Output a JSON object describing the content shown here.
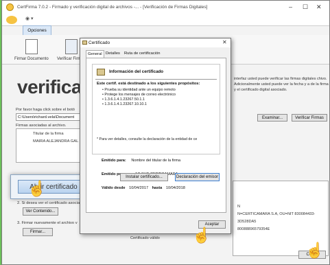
{
  "app": {
    "title": "CertFirma 7.0.2 - Firmado y verificación digital de archivos -... - [Verificación de Firmas Digitales]",
    "tab": "Opciones",
    "toolbar": [
      "Firmar Documento",
      "Verificar Firm"
    ],
    "big_title": "verifica",
    "instruction": "Por favor haga click sobre el botó",
    "path_value": "C:\\Users\\richard.vela\\Document",
    "firmas_label": "Firmas asociadas al archivo.",
    "grid_header": "Titular de la firma",
    "grid_row": "MAIRA ALEJANDRA GAL",
    "examinar_label": "Examinar...",
    "verificar_label": "Verificar Firmas",
    "right_text": "interfaz usted puede verificar las firmas digitales chivo.  Adicionalmente usted puede ver la fecha y a de la firma y el certificado digital asociado.",
    "right_panel_lines": [
      "N",
      "N=CERTICAMARA S.A, OU=NIT 830084433-",
      "3D528DA5",
      "80088896579354E"
    ],
    "step2_partial": "2. Si desea ver el certificado asociado a la firma",
    "ver_contenido_label": "Ver Contenido...",
    "step3": "3. Firmar nuevamente el archivo v",
    "firmar_label": "Firmar...",
    "zoom_button_label": "Abrir certificado",
    "cerrar_label": "Cerrar",
    "certificado_valido": "Certificado válido"
  },
  "dialog": {
    "title": "Certificado",
    "tabs": [
      "General",
      "Detalles",
      "Ruta de certificación"
    ],
    "info_title": "Información del certificado",
    "purpose_heading": "Este certif. está destinado a los siguientes propósitos:",
    "purposes": [
      "• Prueba su identidad ante un equipo remoto",
      "• Protege los mensajes de correo electrónico",
      "• 1.3.6.1.4.1.23267.50.1.1",
      "• 1.3.6.1.4.1.23267.10.10.1"
    ],
    "note": "* Para ver detalles, consulte la declaración de la entidad de ce",
    "issued_to_label": "Emitido para:",
    "issued_to_value": "Nombre del titular de la firma",
    "issued_by_label": "Emitido por:",
    "issued_by_value": "AC SUB CERTICAMARA",
    "valid_from_label": "Válido desde",
    "valid_from_value": "10/04/2017",
    "valid_to_label": "hasta",
    "valid_to_value": "10/04/2018",
    "install_button": "Instalar certificado...",
    "decl_button": "Declaración del emisor",
    "accept_button": "Aceptar"
  },
  "icons": [
    "cursor-hand-icon",
    "certificate-icon",
    "close-icon",
    "minimize-icon",
    "maximize-icon"
  ]
}
